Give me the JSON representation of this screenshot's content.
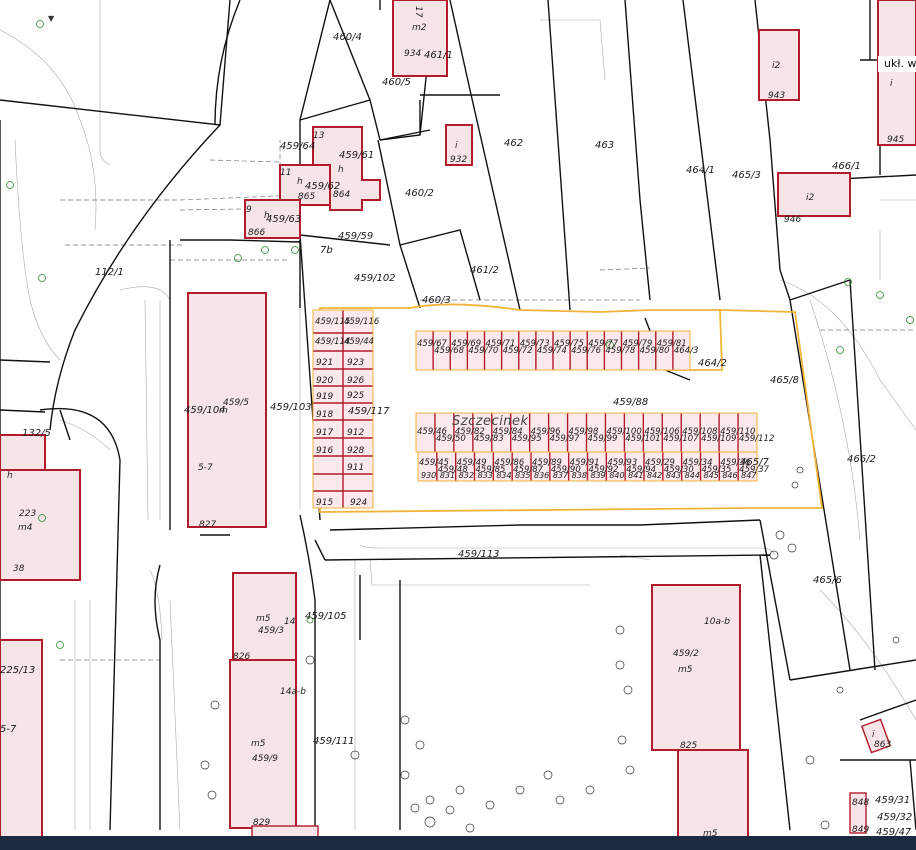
{
  "map": {
    "crs_label": "ukł. w",
    "street_label": "Szczecinek",
    "north_marker": "▼",
    "parcels": [
      {
        "id": "p-460-4",
        "label": "460/4"
      },
      {
        "id": "p-460-5",
        "label": "460/5"
      },
      {
        "id": "p-461-1",
        "label": "461/1"
      },
      {
        "id": "p-460-2",
        "label": "460/2"
      },
      {
        "id": "p-462",
        "label": "462"
      },
      {
        "id": "p-463",
        "label": "463"
      },
      {
        "id": "p-464-1",
        "label": "464/1"
      },
      {
        "id": "p-465-3",
        "label": "465/3"
      },
      {
        "id": "p-466-1",
        "label": "466/1"
      },
      {
        "id": "p-459-64",
        "label": "459/64"
      },
      {
        "id": "p-459-61",
        "label": "459/61"
      },
      {
        "id": "p-459-62",
        "label": "459/62"
      },
      {
        "id": "p-459-63",
        "label": "459/63"
      },
      {
        "id": "p-459-59",
        "label": "459/59"
      },
      {
        "id": "p-7b",
        "label": "7b"
      },
      {
        "id": "p-459-102",
        "label": "459/102"
      },
      {
        "id": "p-461-2",
        "label": "461/2"
      },
      {
        "id": "p-460-3",
        "label": "460/3"
      },
      {
        "id": "p-112-1",
        "label": "112/1"
      },
      {
        "id": "p-459-104",
        "label": "459/104"
      },
      {
        "id": "p-459-103",
        "label": "459/103"
      },
      {
        "id": "p-459-117",
        "label": "459/117"
      },
      {
        "id": "p-459-88",
        "label": "459/88"
      },
      {
        "id": "p-464-2",
        "label": "464/2"
      },
      {
        "id": "p-465-8",
        "label": "465/8"
      },
      {
        "id": "p-466-2",
        "label": "466/2"
      },
      {
        "id": "p-465-7",
        "label": "465/7"
      },
      {
        "id": "p-132-5",
        "label": "132/5"
      },
      {
        "id": "p-459-113",
        "label": "459/113"
      },
      {
        "id": "p-465-6",
        "label": "465/6"
      },
      {
        "id": "p-459-105",
        "label": "459/105"
      },
      {
        "id": "p-459-111",
        "label": "459/111"
      },
      {
        "id": "p-225-13",
        "label": "225/13"
      },
      {
        "id": "p-5-7b",
        "label": "5-7"
      },
      {
        "id": "p-459-31",
        "label": "459/31"
      },
      {
        "id": "p-459-32",
        "label": "459/32"
      },
      {
        "id": "p-459-47",
        "label": "459/47"
      }
    ],
    "buildings": [
      {
        "id": "b-m2",
        "use": "m2",
        "number": "934",
        "extra": "17"
      },
      {
        "id": "b-932",
        "use": "i",
        "number": "932"
      },
      {
        "id": "b-943",
        "use": "i2",
        "number": "943"
      },
      {
        "id": "b-945",
        "use": "i",
        "number": "945"
      },
      {
        "id": "b-946",
        "use": "i2",
        "number": "946"
      },
      {
        "id": "b-864",
        "use": "h",
        "number": "864",
        "extra": "13"
      },
      {
        "id": "b-865",
        "use": "h",
        "number": "865",
        "extra": "11"
      },
      {
        "id": "b-866",
        "use": "h",
        "number": "866",
        "extra": "9"
      },
      {
        "id": "b-459-5",
        "use": "m",
        "number": "827",
        "parcel": "459/5",
        "address": "5-7"
      },
      {
        "id": "b-223",
        "use": "m4",
        "number": "223",
        "extra": "38"
      },
      {
        "id": "b-h-left",
        "use": "h"
      },
      {
        "id": "b-459-3",
        "use": "m5",
        "number": "826",
        "parcel": "459/3",
        "address": "14"
      },
      {
        "id": "b-459-9",
        "use": "m5",
        "number": "829",
        "parcel": "459/9",
        "address": "14a-b"
      },
      {
        "id": "b-459-2",
        "use": "m5",
        "number": "825",
        "parcel": "459/2",
        "address": "10a-b"
      },
      {
        "id": "b-m5-bottom",
        "use": "m5"
      },
      {
        "id": "b-863",
        "use": "i",
        "number": "863"
      },
      {
        "id": "b-848",
        "number": "848"
      },
      {
        "id": "b-849",
        "number": "849"
      }
    ],
    "garage_block_left": {
      "top_labels": [
        "459/115",
        "459/116",
        "459/114",
        "459/44"
      ],
      "numbers": [
        "921",
        "920",
        "919",
        "918",
        "917",
        "916",
        "915",
        "926",
        "925",
        "923",
        "912",
        "928",
        "911",
        "924"
      ]
    },
    "garage_row_top": {
      "labels": [
        "459/67",
        "459/68",
        "459/69",
        "459/70",
        "459/71",
        "459/72",
        "459/73",
        "459/74",
        "459/75",
        "459/76",
        "459/77",
        "459/78",
        "459/79",
        "459/80",
        "459/81",
        "464/3"
      ]
    },
    "garage_row_middle": {
      "labels": [
        "459/46",
        "459/50",
        "459/82",
        "459/83",
        "459/84",
        "459/95",
        "459/96",
        "459/97",
        "459/98",
        "459/99",
        "459/100",
        "459/101",
        "459/106",
        "459/107",
        "459/108",
        "459/109",
        "459/110",
        "459/112"
      ]
    },
    "garage_row_bottom": {
      "labels": [
        "459/45",
        "459/48",
        "459/49",
        "459/85",
        "459/86",
        "459/87",
        "459/89",
        "459/90",
        "459/91",
        "459/92",
        "459/93",
        "459/94",
        "459/29",
        "459/30",
        "459/34",
        "459/35",
        "459/36",
        "459/37"
      ],
      "numbers": [
        "930",
        "831",
        "832",
        "833",
        "834",
        "835",
        "836",
        "837",
        "838",
        "839",
        "840",
        "841",
        "842",
        "843",
        "844",
        "845",
        "846",
        "847"
      ]
    },
    "colors": {
      "building_stroke": "#b21b2c",
      "building_fill": "#f6e4e6",
      "plan_outline": "#f0b43a",
      "parcel_line": "#111111",
      "background": "#ffffff",
      "bottom_bar": "#1c2a40"
    }
  }
}
